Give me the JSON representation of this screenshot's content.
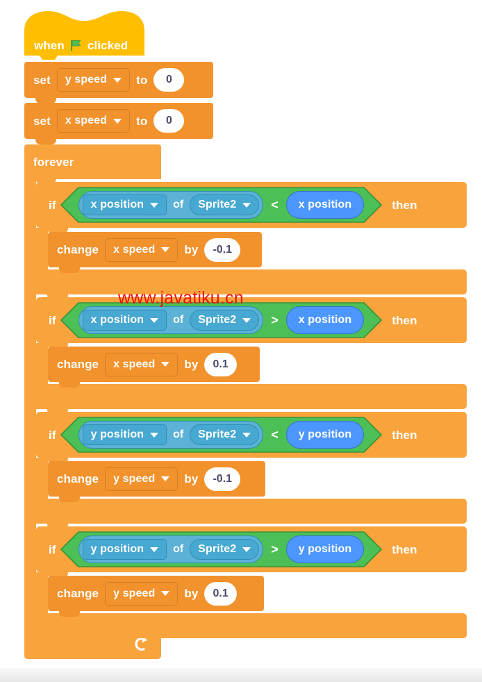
{
  "watermark": "www.javatiku.cn",
  "script": {
    "hat": {
      "when_label": "when",
      "flag_icon": "green-flag-icon",
      "clicked_label": "clicked"
    },
    "set_blocks": [
      {
        "verb": "set",
        "variable": "y speed",
        "connector": "to",
        "value": "0"
      },
      {
        "verb": "set",
        "variable": "x speed",
        "connector": "to",
        "value": "0"
      }
    ],
    "forever": {
      "label": "forever",
      "loop_icon": "loop-arrow-icon"
    },
    "conditions": [
      {
        "if_label": "if",
        "then_label": "then",
        "left": {
          "property": "x position",
          "of": "of",
          "target": "Sprite2"
        },
        "operator": "<",
        "right": "x position",
        "body": {
          "verb": "change",
          "variable": "x speed",
          "connector": "by",
          "value": "-0.1"
        }
      },
      {
        "if_label": "if",
        "then_label": "then",
        "left": {
          "property": "x position",
          "of": "of",
          "target": "Sprite2"
        },
        "operator": ">",
        "right": "x position",
        "body": {
          "verb": "change",
          "variable": "x speed",
          "connector": "by",
          "value": "0.1"
        }
      },
      {
        "if_label": "if",
        "then_label": "then",
        "left": {
          "property": "y position",
          "of": "of",
          "target": "Sprite2"
        },
        "operator": "<",
        "right": "y position",
        "body": {
          "verb": "change",
          "variable": "y speed",
          "connector": "by",
          "value": "-0.1"
        }
      },
      {
        "if_label": "if",
        "then_label": "then",
        "left": {
          "property": "y position",
          "of": "of",
          "target": "Sprite2"
        },
        "operator": ">",
        "right": "y position",
        "body": {
          "verb": "change",
          "variable": "y speed",
          "connector": "by",
          "value": "0.1"
        }
      }
    ]
  },
  "colors": {
    "control": "#f9a33c",
    "variables": "#f2922c",
    "events": "#ffbf00",
    "operators": "#4cbf56",
    "sensing": "#5cb1d6",
    "motion": "#4c97ff",
    "watermark": "#ee1111"
  }
}
